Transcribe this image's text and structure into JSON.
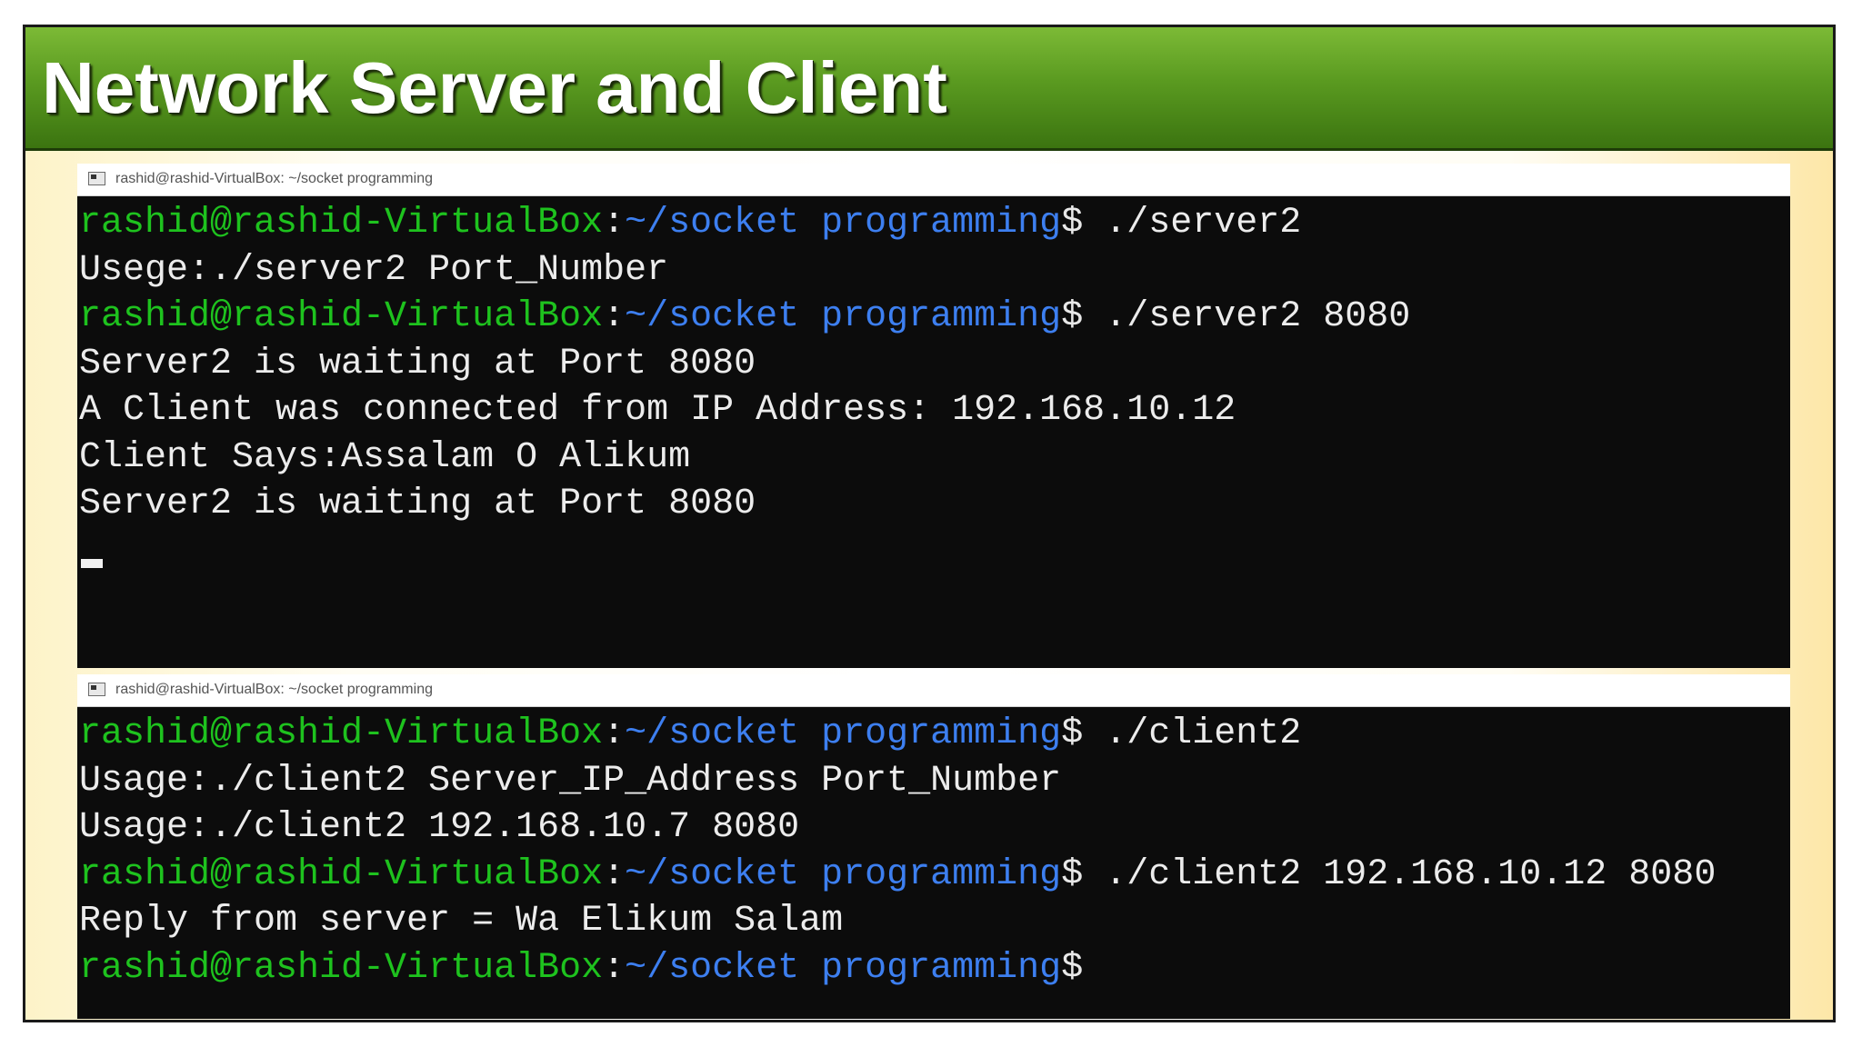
{
  "slide": {
    "title": "Network Server and Client"
  },
  "server_window": {
    "title": "rashid@rashid-VirtualBox: ~/socket programming",
    "lines": [
      {
        "user": "rashid@rashid-VirtualBox",
        "colon": ":",
        "path": "~/socket programming",
        "dollar": "$",
        "cmd": " ./server2"
      },
      {
        "text": "Usege:./server2 Port_Number"
      },
      {
        "user": "rashid@rashid-VirtualBox",
        "colon": ":",
        "path": "~/socket programming",
        "dollar": "$",
        "cmd": " ./server2 8080"
      },
      {
        "text": "Server2 is waiting at Port 8080"
      },
      {
        "text": "A Client was connected from IP Address: 192.168.10.12"
      },
      {
        "text": "Client Says:Assalam O Alikum"
      },
      {
        "text": "Server2 is waiting at Port 8080"
      }
    ]
  },
  "client_window": {
    "title": "rashid@rashid-VirtualBox: ~/socket programming",
    "lines": [
      {
        "user": "rashid@rashid-VirtualBox",
        "colon": ":",
        "path": "~/socket programming",
        "dollar": "$",
        "cmd": " ./client2"
      },
      {
        "text": "Usage:./client2 Server_IP_Address Port_Number"
      },
      {
        "text": "Usage:./client2 192.168.10.7 8080"
      },
      {
        "user": "rashid@rashid-VirtualBox",
        "colon": ":",
        "path": "~/socket programming",
        "dollar": "$",
        "cmd": " ./client2 192.168.10.12 8080"
      },
      {
        "text": "Reply from server = Wa Elikum Salam"
      },
      {
        "user": "rashid@rashid-VirtualBox",
        "colon": ":",
        "path": "~/socket programming",
        "dollar": "$",
        "cmd": ""
      }
    ]
  },
  "colors": {
    "prompt_user": "#1ec21e",
    "prompt_path": "#3d7ff0",
    "terminal_bg": "#0c0c0c",
    "terminal_text": "#ececec",
    "title_bar_green": "#5a9a20"
  },
  "icons": {
    "terminal_window": "terminal-window-icon"
  }
}
